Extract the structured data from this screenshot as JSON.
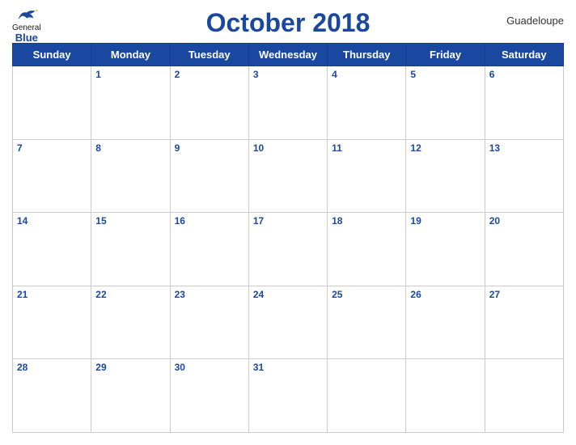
{
  "header": {
    "logo_general": "General",
    "logo_blue": "Blue",
    "title": "October 2018",
    "country": "Guadeloupe"
  },
  "weekdays": [
    "Sunday",
    "Monday",
    "Tuesday",
    "Wednesday",
    "Thursday",
    "Friday",
    "Saturday"
  ],
  "weeks": [
    [
      {
        "num": "",
        "empty": true
      },
      {
        "num": "1"
      },
      {
        "num": "2"
      },
      {
        "num": "3"
      },
      {
        "num": "4"
      },
      {
        "num": "5"
      },
      {
        "num": "6"
      }
    ],
    [
      {
        "num": "7"
      },
      {
        "num": "8"
      },
      {
        "num": "9"
      },
      {
        "num": "10"
      },
      {
        "num": "11"
      },
      {
        "num": "12"
      },
      {
        "num": "13"
      }
    ],
    [
      {
        "num": "14"
      },
      {
        "num": "15"
      },
      {
        "num": "16"
      },
      {
        "num": "17"
      },
      {
        "num": "18"
      },
      {
        "num": "19"
      },
      {
        "num": "20"
      }
    ],
    [
      {
        "num": "21"
      },
      {
        "num": "22"
      },
      {
        "num": "23"
      },
      {
        "num": "24"
      },
      {
        "num": "25"
      },
      {
        "num": "26"
      },
      {
        "num": "27"
      }
    ],
    [
      {
        "num": "28"
      },
      {
        "num": "29"
      },
      {
        "num": "30"
      },
      {
        "num": "31"
      },
      {
        "num": ""
      },
      {
        "num": ""
      },
      {
        "num": ""
      }
    ]
  ]
}
